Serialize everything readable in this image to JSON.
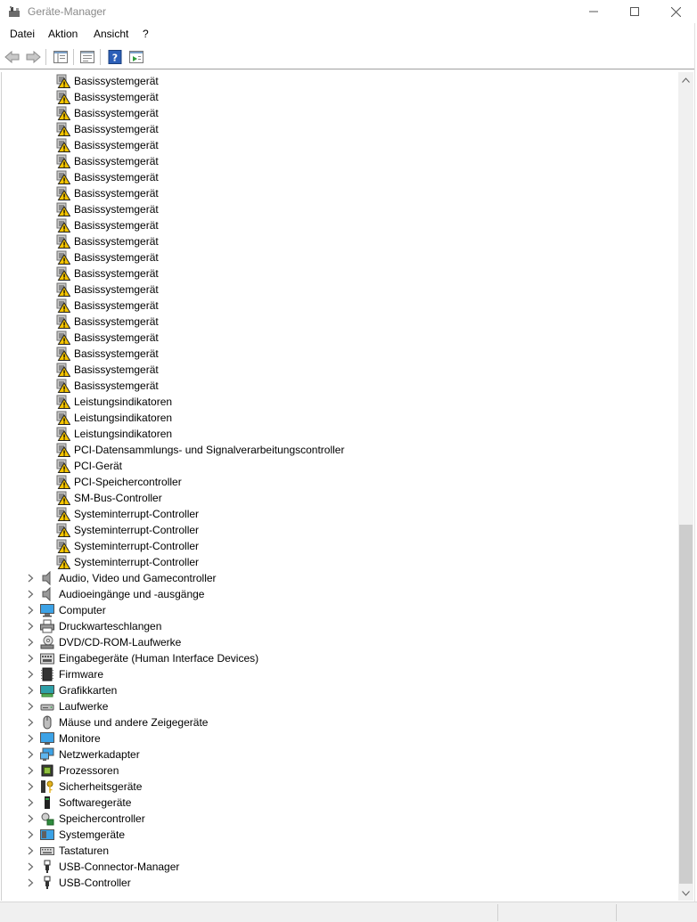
{
  "window": {
    "title": "Geräte-Manager",
    "controls": [
      "minimize",
      "maximize",
      "close"
    ]
  },
  "menu": [
    "Datei",
    "Aktion",
    "Ansicht",
    "?"
  ],
  "toolbar": {
    "buttons": [
      "back-icon",
      "forward-icon",
      "show-hide-console-tree-icon",
      "properties-icon",
      "help-icon",
      "update-driver-icon"
    ]
  },
  "devices": [
    "Basissystemgerät",
    "Basissystemgerät",
    "Basissystemgerät",
    "Basissystemgerät",
    "Basissystemgerät",
    "Basissystemgerät",
    "Basissystemgerät",
    "Basissystemgerät",
    "Basissystemgerät",
    "Basissystemgerät",
    "Basissystemgerät",
    "Basissystemgerät",
    "Basissystemgerät",
    "Basissystemgerät",
    "Basissystemgerät",
    "Basissystemgerät",
    "Basissystemgerät",
    "Basissystemgerät",
    "Basissystemgerät",
    "Basissystemgerät",
    "Leistungsindikatoren",
    "Leistungsindikatoren",
    "Leistungsindikatoren",
    "PCI-Datensammlungs- und Signalverarbeitungscontroller",
    "PCI-Gerät",
    "PCI-Speichercontroller",
    "SM-Bus-Controller",
    "Systeminterrupt-Controller",
    "Systeminterrupt-Controller",
    "Systeminterrupt-Controller",
    "Systeminterrupt-Controller"
  ],
  "categories": [
    {
      "label": "Audio, Video und Gamecontroller",
      "icon": "speaker-icon"
    },
    {
      "label": "Audioeingänge und -ausgänge",
      "icon": "speaker-icon"
    },
    {
      "label": "Computer",
      "icon": "computer-icon"
    },
    {
      "label": "Druckwarteschlangen",
      "icon": "printer-icon"
    },
    {
      "label": "DVD/CD-ROM-Laufwerke",
      "icon": "disc-drive-icon"
    },
    {
      "label": "Eingabegeräte (Human Interface Devices)",
      "icon": "hid-icon"
    },
    {
      "label": "Firmware",
      "icon": "firmware-icon"
    },
    {
      "label": "Grafikkarten",
      "icon": "display-adapter-icon"
    },
    {
      "label": "Laufwerke",
      "icon": "disk-drive-icon"
    },
    {
      "label": "Mäuse und andere Zeigegeräte",
      "icon": "mouse-icon"
    },
    {
      "label": "Monitore",
      "icon": "monitor-icon"
    },
    {
      "label": "Netzwerkadapter",
      "icon": "network-icon"
    },
    {
      "label": "Prozessoren",
      "icon": "processor-icon"
    },
    {
      "label": "Sicherheitsgeräte",
      "icon": "security-key-icon"
    },
    {
      "label": "Softwaregeräte",
      "icon": "software-device-icon"
    },
    {
      "label": "Speichercontroller",
      "icon": "storage-controller-icon"
    },
    {
      "label": "Systemgeräte",
      "icon": "system-devices-icon"
    },
    {
      "label": "Tastaturen",
      "icon": "keyboard-icon"
    },
    {
      "label": "USB-Connector-Manager",
      "icon": "usb-icon"
    },
    {
      "label": "USB-Controller",
      "icon": "usb-icon"
    }
  ],
  "colors": {
    "warning": "#f5c400",
    "accent": "#1e7fd6",
    "scroll_thumb": "#cdcdcd"
  }
}
